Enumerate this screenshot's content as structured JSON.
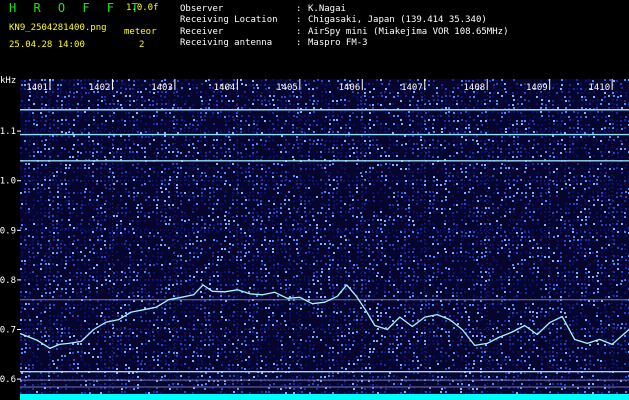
{
  "header": {
    "title": "H R O F F T",
    "version": "1.0.0f",
    "file_name": "KN9_2504281400.png",
    "date_time": "25.04.28 14:00",
    "meteor_label": "meteor",
    "meteor_count": "2",
    "info": [
      {
        "label": "Observer",
        "value": "K.Nagai"
      },
      {
        "label": "Receiving Location",
        "value": "Chigasaki, Japan (139.414 35.340)"
      },
      {
        "label": "Receiver",
        "value": "AirSpy mini (Miakejima VOR 108.65MHz)"
      },
      {
        "label": "Receiving antenna",
        "value": "Maspro FM-3"
      }
    ],
    "separator": ":"
  },
  "colors": {
    "background": "#000000",
    "noise_dark": "#0a0f6e",
    "noise_light": "#4d8cff",
    "trace": "#aaf5ff",
    "baseline": "#00ffff",
    "title": "#19e419",
    "meta": "#ffff00"
  },
  "chart_data": {
    "type": "heatmap",
    "ylabel": "kHz",
    "x_ticks": [
      "1401",
      "1402",
      "1403",
      "1404",
      "1405",
      "1406",
      "1407",
      "1408",
      "1409",
      "1410"
    ],
    "xlim": [
      1400.52,
      1410.27
    ],
    "y_ticks": [
      1.1,
      1.0,
      0.9,
      0.8,
      0.7,
      0.6
    ],
    "y_tick_labels": [
      "1.1",
      "1.0",
      "0.9",
      "0.8",
      "0.7",
      "0.6"
    ],
    "ylim": [
      0.57,
      1.205
    ],
    "carrier_lines_khz": [
      1.143,
      1.093,
      1.04,
      0.76,
      0.615,
      0.598,
      0.584
    ],
    "doppler_trace": {
      "x": [
        1400.52,
        1400.8,
        1401.0,
        1401.15,
        1401.3,
        1401.5,
        1401.7,
        1401.9,
        1402.1,
        1402.3,
        1402.5,
        1402.7,
        1402.9,
        1403.1,
        1403.3,
        1403.45,
        1403.6,
        1403.8,
        1404.0,
        1404.2,
        1404.4,
        1404.6,
        1404.8,
        1405.0,
        1405.2,
        1405.4,
        1405.6,
        1405.75,
        1405.9,
        1406.05,
        1406.2,
        1406.4,
        1406.6,
        1406.8,
        1407.0,
        1407.2,
        1407.4,
        1407.6,
        1407.8,
        1408.0,
        1408.2,
        1408.4,
        1408.6,
        1408.8,
        1409.0,
        1409.2,
        1409.4,
        1409.6,
        1409.8,
        1410.0,
        1410.27
      ],
      "y": [
        0.692,
        0.678,
        0.662,
        0.67,
        0.672,
        0.676,
        0.7,
        0.715,
        0.72,
        0.735,
        0.74,
        0.745,
        0.76,
        0.765,
        0.77,
        0.79,
        0.777,
        0.776,
        0.78,
        0.772,
        0.77,
        0.775,
        0.763,
        0.765,
        0.752,
        0.755,
        0.767,
        0.79,
        0.768,
        0.74,
        0.708,
        0.7,
        0.725,
        0.706,
        0.725,
        0.73,
        0.72,
        0.7,
        0.668,
        0.672,
        0.685,
        0.695,
        0.708,
        0.69,
        0.714,
        0.726,
        0.68,
        0.672,
        0.68,
        0.67,
        0.7
      ]
    }
  }
}
